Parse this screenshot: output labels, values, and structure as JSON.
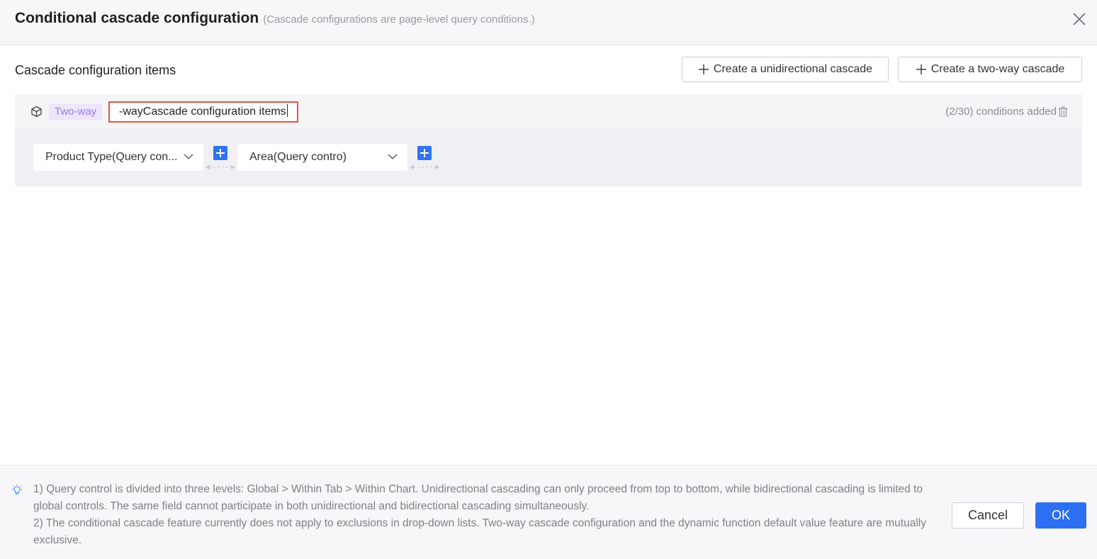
{
  "dialog": {
    "title": "Conditional cascade configuration",
    "subtitle": "(Cascade configurations are page-level query conditions.)"
  },
  "section": {
    "title": "Cascade configuration items",
    "create_unidirectional_label": "Create a unidirectional cascade",
    "create_twoway_label": "Create a two-way cascade"
  },
  "cascade_group": {
    "tag": "Two-way",
    "name_value": "-wayCascade configuration items",
    "count_text": "(2/30) conditions added",
    "conditions": [
      {
        "label": "Product Type(Query con..."
      },
      {
        "label": "Area(Query contro)"
      }
    ]
  },
  "footer": {
    "tips": [
      "1) Query control is divided into three levels: Global > Within Tab > Within Chart. Unidirectional cascading can only proceed from top to bottom, while bidirectional cascading is limited to global controls. The same field cannot participate in both unidirectional and bidirectional cascading simultaneously.",
      "2) The conditional cascade feature currently does not apply to exclusions in drop-down lists. Two-way cascade configuration and the dynamic function default value feature are mutually exclusive."
    ],
    "cancel_label": "Cancel",
    "ok_label": "OK"
  },
  "colors": {
    "primary": "#2d6ff2",
    "tag_text": "#9b7ae8",
    "tag_bg": "#ece6fb",
    "highlight_border": "#e8543f"
  },
  "icons": [
    "close-icon",
    "plus-icon",
    "cube-icon",
    "trash-icon",
    "chevron-down-icon",
    "add-icon",
    "bidirectional-arrow-icon",
    "lightbulb-icon"
  ]
}
